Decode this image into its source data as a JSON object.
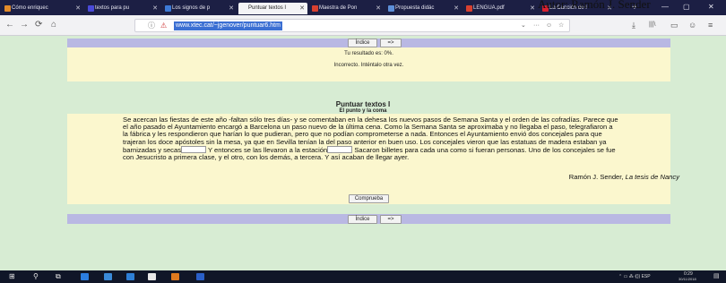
{
  "author_header": "Autor: Ramón J. Sender",
  "browser": {
    "tabs": [
      {
        "label": "Cómo enriquec",
        "color": "#e38b2a"
      },
      {
        "label": "textos para pu",
        "color": "#4a4ad8"
      },
      {
        "label": "Los signos de p",
        "color": "#3d7ad6"
      },
      {
        "label": "Puntuar textos I",
        "color": "#f4f4f6"
      },
      {
        "label": "Maestra de Pon",
        "color": "#d8402f"
      },
      {
        "label": "Propuesta didác",
        "color": "#5d8fd8"
      },
      {
        "label": "LENGUA.pdf",
        "color": "#d8402f"
      },
      {
        "label": "La Canción de l",
        "color": "#d8202f"
      }
    ],
    "new_tab": "+",
    "window_controls": [
      "—",
      "▢",
      "✕"
    ],
    "nav": {
      "back": "←",
      "forward": "→",
      "reload": "⟳",
      "home": "⌂"
    },
    "url": "www.xtec.cat/~jgenover/puntuar6.htm",
    "url_icons": [
      "ⓘ",
      "⚠"
    ],
    "url_right": [
      "⌄",
      "···",
      "☺",
      "☆"
    ],
    "toolbar_right": [
      "⤓",
      "|||\\",
      "▭",
      "☺",
      "≡"
    ]
  },
  "page": {
    "index_button": "Índice",
    "next_button": "=>",
    "result": "Tu resultado es: 0%.",
    "feedback": "Incorrecto. Inténtalo otra vez.",
    "title": "Puntuar textos I",
    "subtitle": "El punto y la coma",
    "paragraph_part1": "Se acercan las fiestas de este año -faltan sólo tres días- y se comentaban en la dehesa los nuevos pasos de Semana Santa y el orden de las cofradías. Parece que el año pasado el Ayuntamiento encargó a Barcelona un paso nuevo de la última cena. Como la Semana Santa se aproximaba y no llegaba el paso, telegrafiaron a la fábrica y les respondieron que harían lo que pudieran, pero que no podían comprometerse a nada. Entonces el Ayuntamiento envió dos concejales para que trajeran los doce apóstoles sin la mesa, ya que en Sevilla tenían la del paso anterior en buen uso. Los concejales vieron que las estatuas de madera estaban ya barnizadas y secas",
    "paragraph_part2": " Y entonces se las llevaron a la estación",
    "paragraph_part3": " Sacaron billetes para cada una como si fueran personas. Uno de los concejales se fue con Jesucristo a primera clase, y el otro, con los demás, a tercera. Y así acaban de llegar ayer.",
    "signature_author": "Ramón J. Sender, ",
    "signature_book": "La tesis de Nancy",
    "check_button": "Comprueba"
  },
  "taskbar": {
    "start": "⊞",
    "search": "⚲",
    "taskview": "⧉",
    "apps": [
      "#2b7de0",
      "#3a8ad8",
      "#2e7fd6",
      "#e8e8e8",
      "#e07a1e",
      "#2a5fc8"
    ],
    "tray": "⌃  ▭  ⁂  ⟪))  ESP",
    "time": "0:29",
    "date": "30/11/2018"
  }
}
